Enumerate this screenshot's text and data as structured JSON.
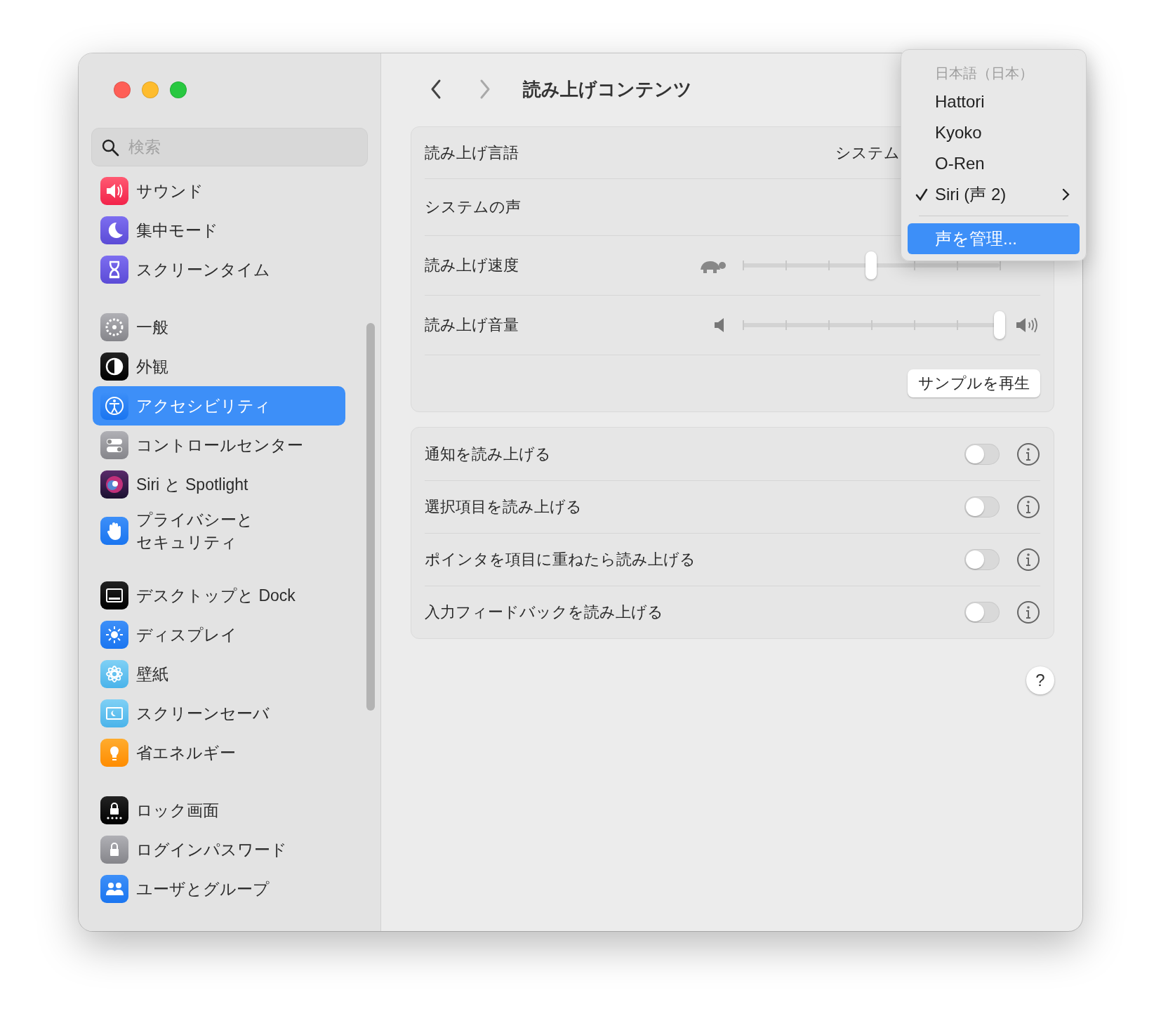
{
  "window": {
    "title": "読み上げコンテンツ",
    "nav": [
      {
        "kind": "back",
        "disabled": false
      },
      {
        "kind": "forward",
        "disabled": true
      }
    ]
  },
  "sidebar": {
    "search": {
      "placeholder": "検索"
    },
    "groups": [
      {
        "items": [
          {
            "label": "サウンド",
            "selected": false
          },
          {
            "label": "集中モード",
            "selected": false
          },
          {
            "label": "スクリーンタイム",
            "selected": false
          }
        ]
      },
      {
        "items": [
          {
            "label": "一般",
            "selected": false
          },
          {
            "label": "外観",
            "selected": false
          },
          {
            "label": "アクセシビリティ",
            "selected": true
          },
          {
            "label": "コントロールセンター",
            "selected": false
          },
          {
            "label": "Siri と Spotlight",
            "selected": false
          },
          {
            "lines": [
              "プライバシーと",
              "セキュリティ"
            ],
            "selected": false
          }
        ]
      },
      {
        "items": [
          {
            "label": "デスクトップと Dock",
            "selected": false
          },
          {
            "label": "ディスプレイ",
            "selected": false
          },
          {
            "label": "壁紙",
            "selected": false
          },
          {
            "label": "スクリーンセーバ",
            "selected": false
          },
          {
            "label": "省エネルギー",
            "selected": false
          }
        ]
      },
      {
        "items": [
          {
            "label": "ロック画面",
            "selected": false
          },
          {
            "label": "ログインパスワード",
            "selected": false
          },
          {
            "label": "ユーザとグループ",
            "selected": false
          }
        ]
      }
    ]
  },
  "speech_settings": {
    "rows": [
      {
        "kind": "value",
        "label": "読み上げ言語",
        "value": "システム"
      },
      {
        "kind": "value",
        "label": "システムの声"
      },
      {
        "kind": "speed_slider",
        "label": "読み上げ速度",
        "level": 0.5
      },
      {
        "kind": "volume_slider",
        "label": "読み上げ音量",
        "level": 1
      }
    ],
    "button": "サンプルを再生"
  },
  "speak_options": [
    {
      "label": "通知を読み上げる",
      "on": false
    },
    {
      "label": "選択項目を読み上げる",
      "on": false
    },
    {
      "label": "ポインタを項目に重ねたら読み上げる",
      "on": false
    },
    {
      "label": "入力フィードバックを読み上げる",
      "on": false
    }
  ],
  "help_button": "?",
  "voice_menu": {
    "header": "日本語（日本）",
    "items": [
      {
        "label": "Hattori",
        "selected": false,
        "submenu": false
      },
      {
        "label": "Kyoko",
        "selected": false,
        "submenu": false
      },
      {
        "label": "O-Ren",
        "selected": false,
        "submenu": false
      },
      {
        "label": "Siri (声 2)",
        "selected": true,
        "submenu": true
      }
    ],
    "action": {
      "label": "声を管理...",
      "highlighted": true
    }
  }
}
